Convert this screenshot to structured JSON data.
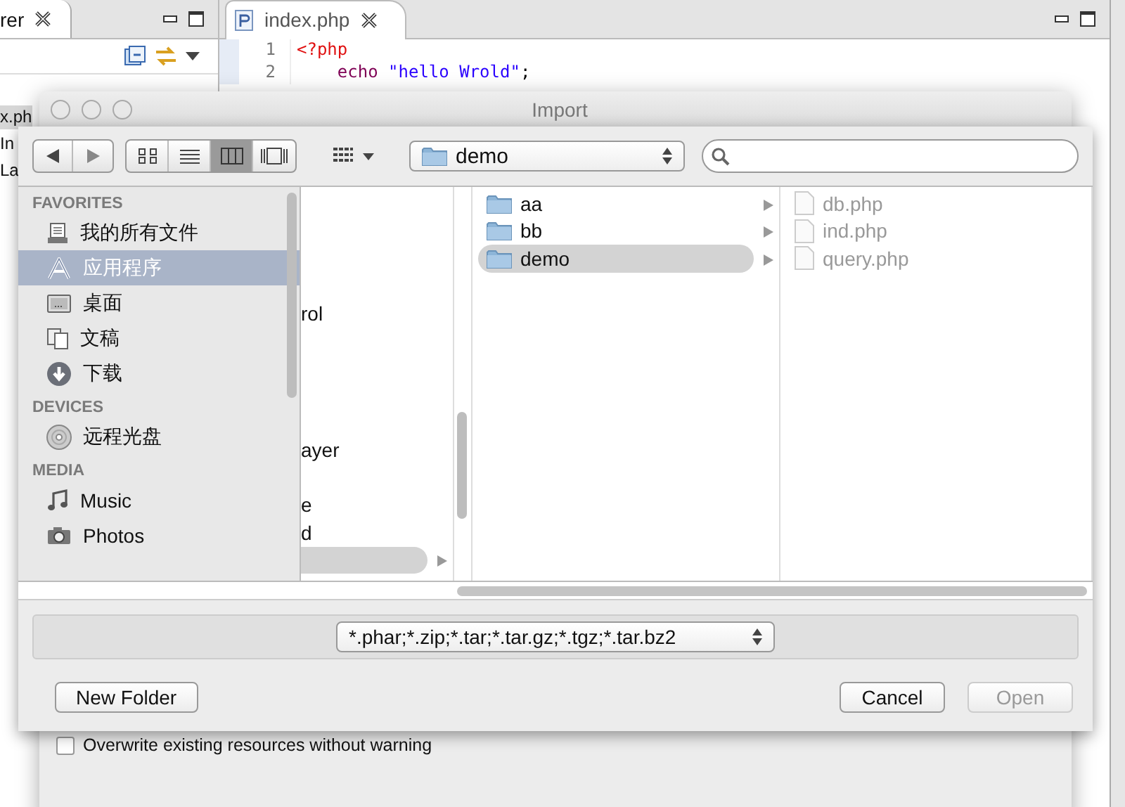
{
  "explorer": {
    "tab_label": "rer",
    "items": [
      {
        "label": "x.ph",
        "selected": true
      },
      {
        "label": "In",
        "selected": false
      },
      {
        "label": "La",
        "selected": false
      }
    ]
  },
  "editor": {
    "tab_label": "index.php",
    "lines": [
      {
        "number": "1",
        "tokens": [
          {
            "kind": "tag",
            "text": "<?php"
          }
        ]
      },
      {
        "number": "2",
        "tokens": [
          {
            "kind": "keyword",
            "text": "echo"
          },
          {
            "kind": "string",
            "text": "\"hello Wrold\""
          },
          {
            "kind": "plain",
            "text": ";"
          }
        ]
      }
    ]
  },
  "import_window": {
    "title": "Import",
    "overwrite": {
      "label": "Overwrite existing resources without warning",
      "checked": false
    }
  },
  "open_sheet": {
    "view_modes": [
      {
        "kind": "icons",
        "selected": false
      },
      {
        "kind": "list",
        "selected": false
      },
      {
        "kind": "columns",
        "selected": true
      },
      {
        "kind": "coverflow",
        "selected": false
      }
    ],
    "location": "demo",
    "sidebar": [
      {
        "heading": "FAVORITES",
        "items": [
          {
            "kind": "files",
            "label": "我的所有文件",
            "selected": false
          },
          {
            "kind": "apps",
            "label": "应用程序",
            "selected": true
          },
          {
            "kind": "desktop",
            "label": "桌面",
            "selected": false
          },
          {
            "kind": "documents",
            "label": "文稿",
            "selected": false
          },
          {
            "kind": "downloads",
            "label": "下载",
            "selected": false
          }
        ]
      },
      {
        "heading": "DEVICES",
        "items": [
          {
            "kind": "disc",
            "label": "远程光盘",
            "selected": false
          }
        ]
      },
      {
        "heading": "MEDIA",
        "items": [
          {
            "kind": "music",
            "label": "Music",
            "selected": false
          },
          {
            "kind": "photos",
            "label": "Photos",
            "selected": false
          }
        ]
      }
    ],
    "column_1": [
      {
        "text": "rol",
        "selected": false
      },
      {
        "text": "ayer",
        "selected": false
      },
      {
        "text": "e",
        "selected": false
      },
      {
        "text": "d",
        "selected": false
      },
      {
        "selected": true
      }
    ],
    "column_2": [
      {
        "name": "aa",
        "selected": false
      },
      {
        "name": "bb",
        "selected": false
      },
      {
        "name": "demo",
        "selected": true
      }
    ],
    "column_3": [
      {
        "name": "db.php",
        "disabled": true
      },
      {
        "name": "ind.php",
        "disabled": true
      },
      {
        "name": "query.php",
        "disabled": true
      }
    ],
    "file_type": "*.phar;*.zip;*.tar;*.tar.gz;*.tgz;*.tar.bz2",
    "buttons": [
      {
        "label": "New Folder",
        "disabled": false
      },
      {
        "label": "Cancel",
        "disabled": false
      },
      {
        "label": "Open",
        "disabled": true
      }
    ]
  }
}
